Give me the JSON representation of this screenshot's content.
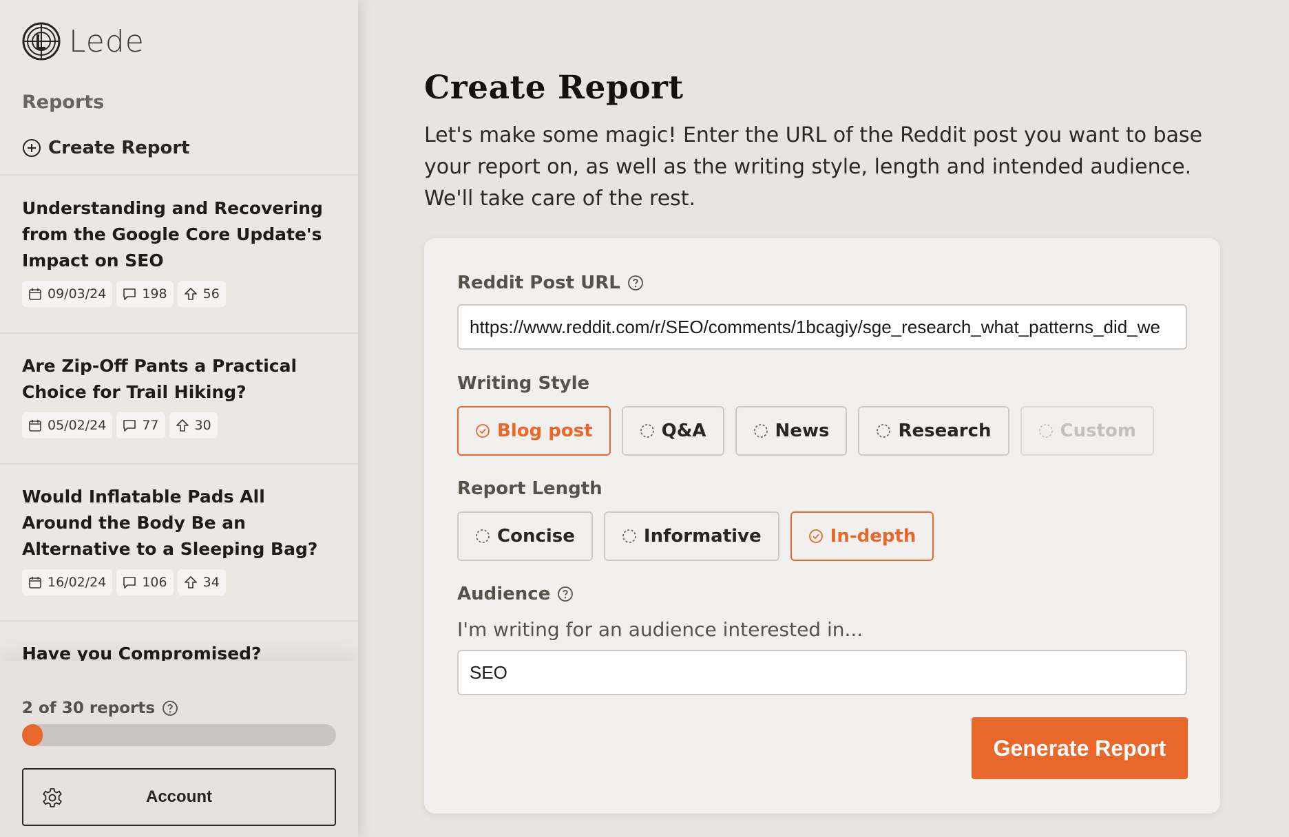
{
  "brand": {
    "name": "Lede",
    "accent": "#e8672a"
  },
  "sidebar": {
    "section_title": "Reports",
    "create_label": "Create Report",
    "reports": [
      {
        "title": "Understanding and Recovering from the Google Core Update's Impact on SEO",
        "date": "09/03/24",
        "comments": "198",
        "upvotes": "56"
      },
      {
        "title": "Are Zip-Off Pants a Practical Choice for Trail Hiking?",
        "date": "05/02/24",
        "comments": "77",
        "upvotes": "30"
      },
      {
        "title": "Would Inflatable Pads All Around the Body Be an Alternative to a Sleeping Bag?",
        "date": "16/02/24",
        "comments": "106",
        "upvotes": "34"
      },
      {
        "title": "Have you Compromised?"
      }
    ],
    "usage": {
      "label": "2 of 30 reports",
      "used": 2,
      "total": 30
    },
    "account_label": "Account"
  },
  "main": {
    "title": "Create Report",
    "intro": "Let's make some magic! Enter the URL of the Reddit post you want to base your report on, as well as the writing style, length and intended audience. We'll take care of the rest.",
    "url_label": "Reddit Post URL",
    "url_value": "https://www.reddit.com/r/SEO/comments/1bcagiy/sge_research_what_patterns_did_we",
    "style_label": "Writing Style",
    "styles": [
      {
        "label": "Blog post",
        "state": "selected"
      },
      {
        "label": "Q&A",
        "state": "default"
      },
      {
        "label": "News",
        "state": "default"
      },
      {
        "label": "Research",
        "state": "default"
      },
      {
        "label": "Custom",
        "state": "disabled"
      }
    ],
    "length_label": "Report Length",
    "lengths": [
      {
        "label": "Concise",
        "state": "default"
      },
      {
        "label": "Informative",
        "state": "default"
      },
      {
        "label": "In-depth",
        "state": "selected"
      }
    ],
    "audience_label": "Audience",
    "audience_hint": "I'm writing for an audience interested in...",
    "audience_value": "SEO",
    "generate_label": "Generate Report"
  }
}
